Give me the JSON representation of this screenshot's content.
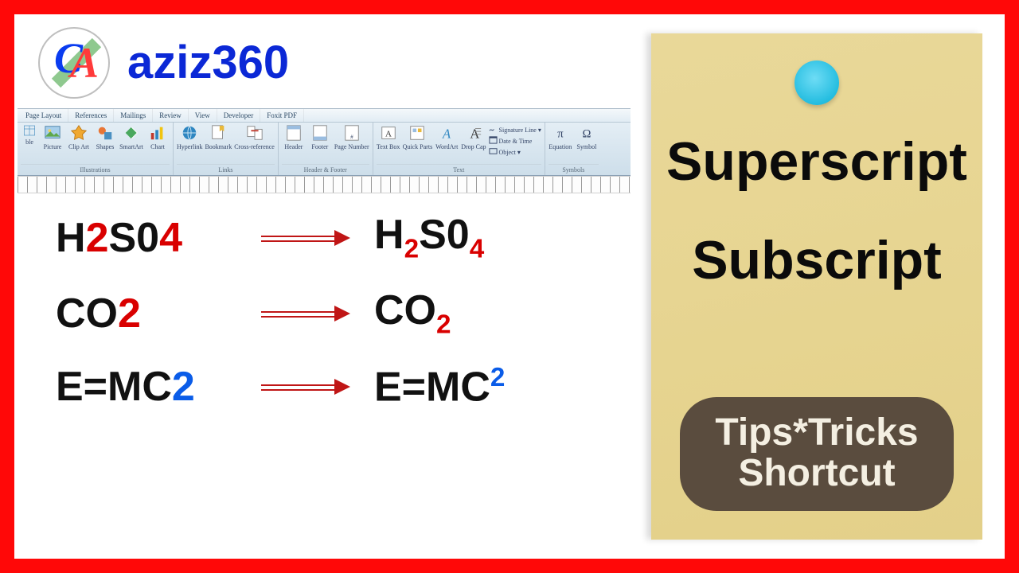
{
  "brand": {
    "text": "aziz360",
    "logo_c": "C",
    "logo_a": "A"
  },
  "ribbon": {
    "tabs": [
      "Page Layout",
      "References",
      "Mailings",
      "Review",
      "View",
      "Developer",
      "Foxit PDF"
    ],
    "groups": [
      {
        "label": "Illustrations",
        "items": [
          "Picture",
          "Clip Art",
          "Shapes",
          "SmartArt",
          "Chart"
        ],
        "head": "ble"
      },
      {
        "label": "Links",
        "items": [
          "Hyperlink",
          "Bookmark",
          "Cross-reference"
        ]
      },
      {
        "label": "Header & Footer",
        "items": [
          "Header",
          "Footer",
          "Page Number"
        ]
      },
      {
        "label": "Text",
        "items": [
          "Text Box",
          "Quick Parts",
          "WordArt",
          "Drop Cap"
        ],
        "side": [
          "Signature Line",
          "Date & Time",
          "Object"
        ]
      },
      {
        "label": "Symbols",
        "items": [
          "Equation",
          "Symbol"
        ]
      }
    ]
  },
  "samples": [
    {
      "before_html": "H<span class='red'>2</span>S0<span class='red'>4</span>",
      "after_html": "H<sub class='red'>2</sub>S0<sub class='red'>4</sub>"
    },
    {
      "before_html": "CO<span class='red'>2</span>",
      "after_html": "CO<sub class='red'>2</sub>"
    },
    {
      "before_html": "E=MC<span class='blue'>2</span>",
      "after_html": "E=MC<sup class='blue'>2</sup>"
    }
  ],
  "card": {
    "line1": "Superscript",
    "line2": "Subscript",
    "pill1": "Tips*Tricks",
    "pill2": "Shortcut"
  }
}
